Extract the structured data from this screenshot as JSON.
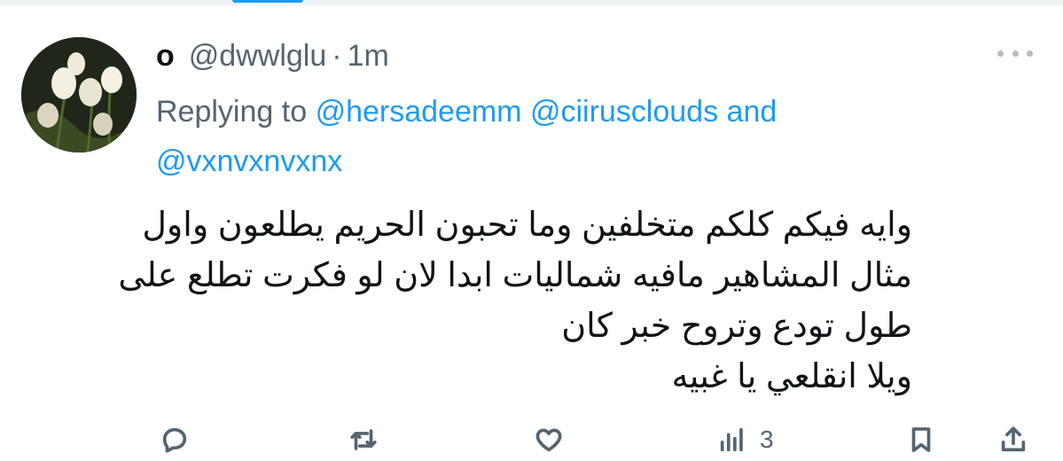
{
  "tweet": {
    "display_name": "o",
    "handle": "@dwwlglu",
    "separator": "·",
    "time": "1m",
    "replying_prefix": "Replying to",
    "mentions": [
      "@hersadeemm",
      "@ciirusclouds",
      "@vxnvxnvxnx"
    ],
    "conjunction": "and",
    "text_lines": [
      "وايه فيكم كلكم متخلفين وما تحبون الحريم يطلعون واول",
      "مثال المشاهير مافيه شماليات ابدا لان لو فكرت تطلع على",
      "طول تودع وتروح خبر كان",
      "ويلا انقلعي يا غبيه"
    ]
  },
  "actions": {
    "reply": {
      "icon": "reply-icon"
    },
    "retweet": {
      "icon": "retweet-icon"
    },
    "like": {
      "icon": "heart-icon"
    },
    "views": {
      "icon": "views-icon",
      "count": "3"
    },
    "bookmark": {
      "icon": "bookmark-icon"
    },
    "share": {
      "icon": "share-icon"
    }
  },
  "colors": {
    "accent": "#1d9bf0",
    "secondary_text": "#536471",
    "primary_text": "#0f1419"
  }
}
